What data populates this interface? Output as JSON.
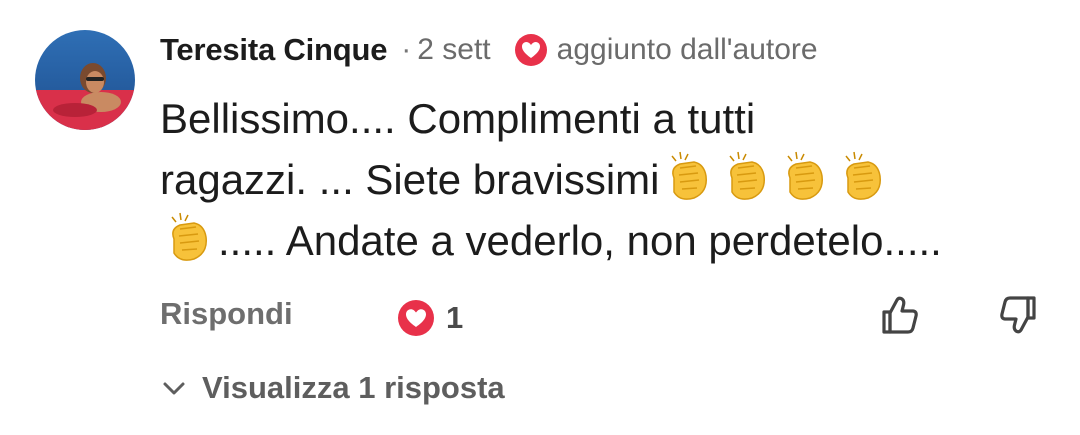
{
  "comment": {
    "author": "Teresita Cinque",
    "separator": "·",
    "timestamp": "2 sett",
    "author_badge": {
      "icon": "heart-badge-icon",
      "label": "aggiunto dall'autore"
    },
    "body": {
      "line1": "Bellissimo.... Complimenti a tutti",
      "line2_text": "ragazzi. ... Siete bravissimi",
      "line3_text": "..... Andate a vederlo, non perdetelo.....",
      "emoji": "clapping-hands-icon"
    }
  },
  "actions": {
    "reply_label": "Rispondi",
    "likes_count": "1",
    "likes_icon": "heart-icon",
    "upvote_icon": "thumbs-up-icon",
    "downvote_icon": "thumbs-down-icon"
  },
  "replies": {
    "label": "Visualizza 1 risposta",
    "icon": "chevron-down-icon"
  },
  "colors": {
    "heart": "#e8314a",
    "text_primary": "#1c1c1c",
    "text_secondary": "#6b6b6b",
    "emoji_yellow": "#f7c23a"
  }
}
